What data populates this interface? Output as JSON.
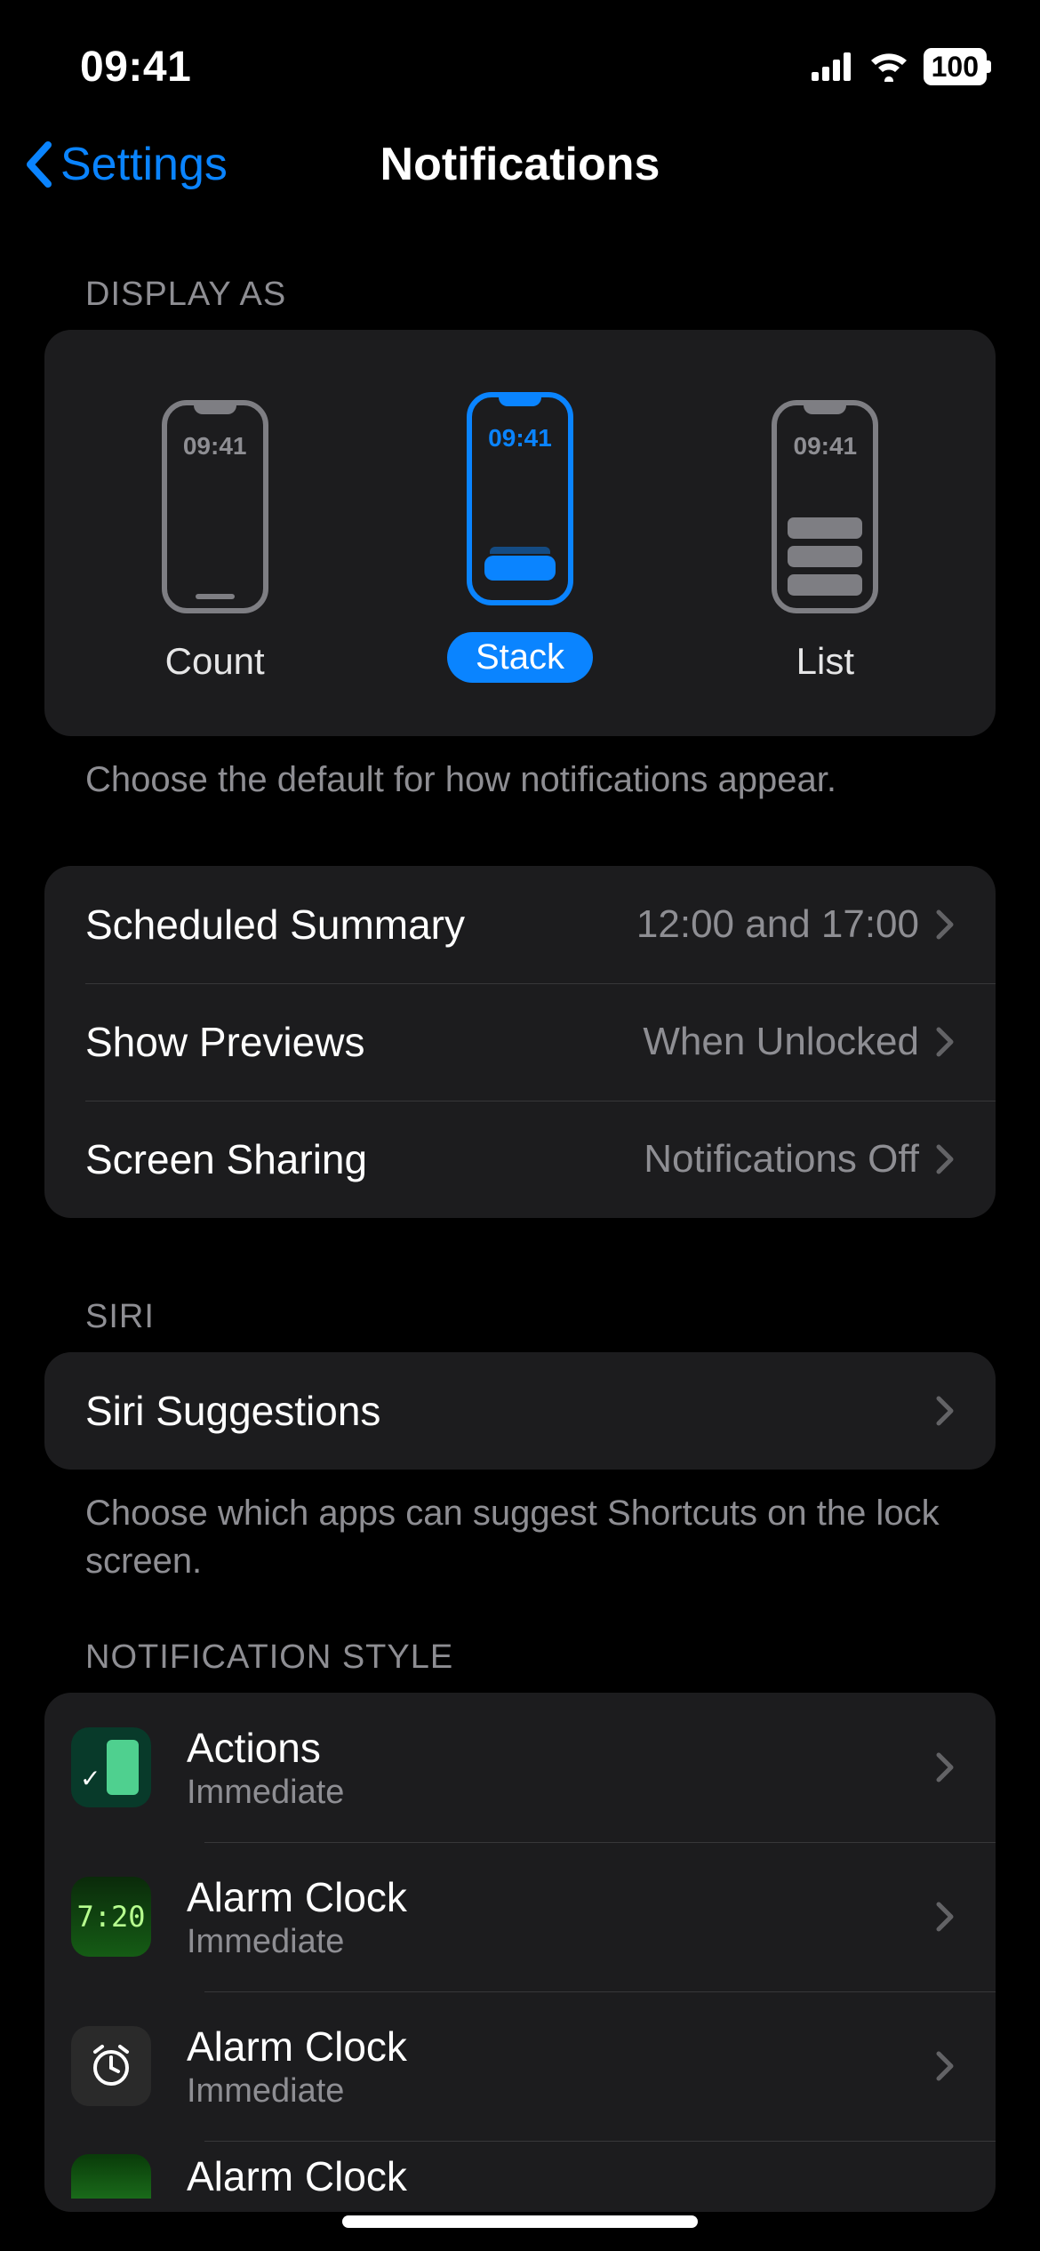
{
  "status": {
    "time": "09:41",
    "battery": "100"
  },
  "nav": {
    "back_label": "Settings",
    "title": "Notifications"
  },
  "display_as": {
    "header": "Display As",
    "phone_time": "09:41",
    "options": {
      "count": "Count",
      "stack": "Stack",
      "list": "List"
    },
    "selected": "stack",
    "footer": "Choose the default for how notifications appear."
  },
  "settings_rows": {
    "scheduled_summary": {
      "label": "Scheduled Summary",
      "value": "12:00 and 17:00"
    },
    "show_previews": {
      "label": "Show Previews",
      "value": "When Unlocked"
    },
    "screen_sharing": {
      "label": "Screen Sharing",
      "value": "Notifications Off"
    }
  },
  "siri": {
    "header": "Siri",
    "row_label": "Siri Suggestions",
    "footer": "Choose which apps can suggest Shortcuts on the lock screen."
  },
  "notification_style": {
    "header": "Notification Style",
    "apps": [
      {
        "name": "Actions",
        "subtitle": "Immediate",
        "icon": "actions"
      },
      {
        "name": "Alarm Clock",
        "subtitle": "Immediate",
        "icon": "alarm1",
        "icon_text": "7:20"
      },
      {
        "name": "Alarm Clock",
        "subtitle": "Immediate",
        "icon": "alarm2"
      },
      {
        "name": "Alarm Clock",
        "subtitle": "",
        "icon": "alarm3"
      }
    ]
  }
}
